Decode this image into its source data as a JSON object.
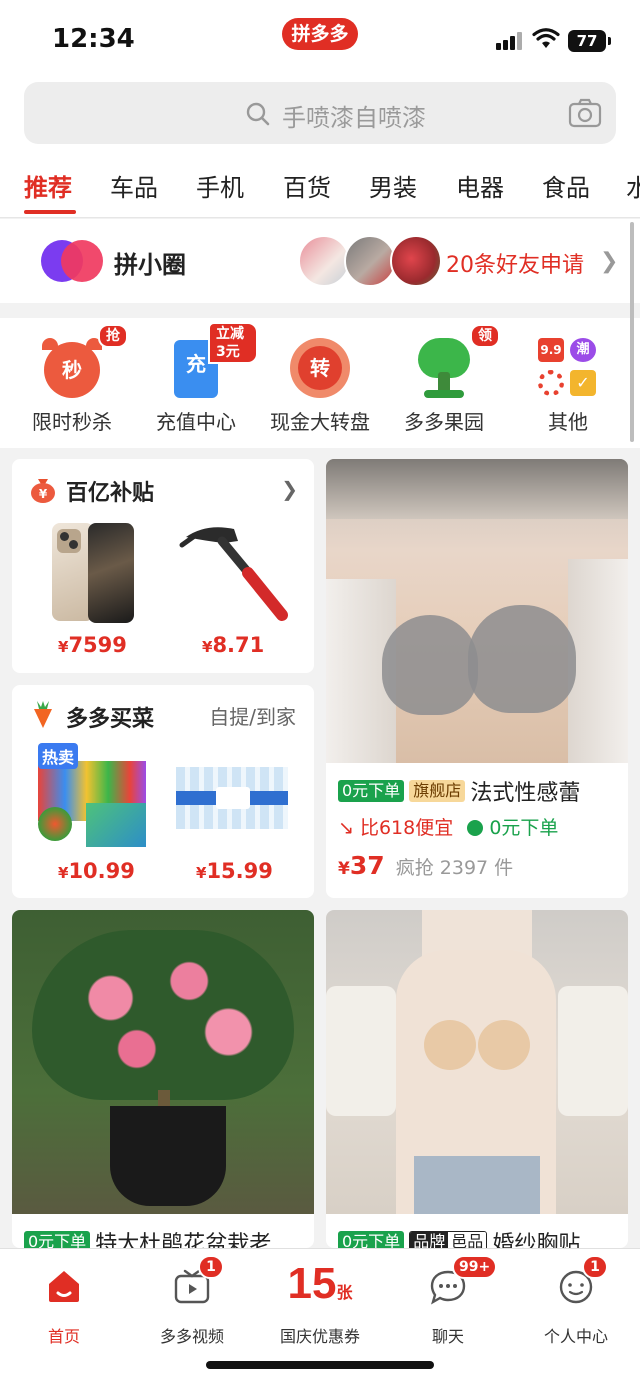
{
  "status": {
    "time": "12:34",
    "app_badge": "拼多多",
    "battery": "77"
  },
  "search": {
    "placeholder": "手喷漆自喷漆"
  },
  "tabs": [
    {
      "label": "推荐",
      "active": true
    },
    {
      "label": "车品"
    },
    {
      "label": "手机"
    },
    {
      "label": "百货"
    },
    {
      "label": "男装"
    },
    {
      "label": "电器"
    },
    {
      "label": "食品"
    },
    {
      "label": "水"
    }
  ],
  "circle": {
    "title": "拼小圈",
    "friend_requests": "20条好友申请"
  },
  "quick": [
    {
      "label": "限时秒杀",
      "icon": "seckill-clock-icon",
      "icon_text": "秒",
      "tag": "抢"
    },
    {
      "label": "充值中心",
      "icon": "recharge-phone-icon",
      "icon_text": "充",
      "tag": "立减3元"
    },
    {
      "label": "现金大转盘",
      "icon": "cash-wheel-icon",
      "icon_text": "转",
      "tag": ""
    },
    {
      "label": "多多果园",
      "icon": "orchard-tree-icon",
      "icon_text": "",
      "tag": "领"
    },
    {
      "label": "其他",
      "icon": "other-grid-icon",
      "icon_text": "9.9",
      "icon_text2": "潮",
      "tag": ""
    }
  ],
  "subsidy": {
    "title": "百亿补贴",
    "items": [
      {
        "price_symbol": "¥",
        "price": "7599"
      },
      {
        "price_symbol": "¥",
        "price": "8.71"
      }
    ]
  },
  "grocery": {
    "title": "多多买菜",
    "subtitle": "自提/到家",
    "items": [
      {
        "price_symbol": "¥",
        "price": "10.99",
        "tag": "热卖"
      },
      {
        "price_symbol": "¥",
        "price": "15.99"
      }
    ]
  },
  "product1": {
    "tag1": "0元下单",
    "tag2": "旗舰店",
    "title": "法式性感蕾",
    "compare": "比618便宜",
    "zero": "0元下单",
    "price_symbol": "¥",
    "price": "37",
    "sold": "疯抢 2397 件"
  },
  "product2": {
    "tag1": "0元下单",
    "title": "特大杜鹃花盆栽老"
  },
  "product3": {
    "tag1": "0元下单",
    "tag2a": "品牌",
    "tag2b": "邑品",
    "title": "婚纱胸贴"
  },
  "bottom_nav": [
    {
      "label": "首页",
      "active": true,
      "badge": ""
    },
    {
      "label": "多多视频",
      "badge": "1"
    },
    {
      "label": "国庆优惠券",
      "big": "15",
      "unit": "张"
    },
    {
      "label": "聊天",
      "badge": "99+"
    },
    {
      "label": "个人中心",
      "badge": "1"
    }
  ],
  "colors": {
    "brand": "#e02e24",
    "green": "#1aa24c"
  }
}
